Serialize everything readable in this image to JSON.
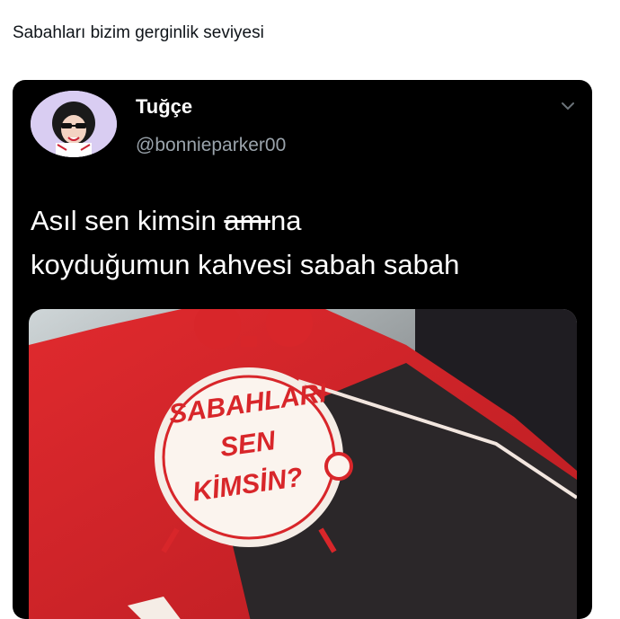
{
  "post": {
    "caption": "Sabahları bizim gerginlik seviyesi"
  },
  "tweet": {
    "author_name": "Tuğçe",
    "author_handle": "@bonnieparker00",
    "text_part1": "Asıl sen kimsin ",
    "text_redacted": "amı",
    "text_part2": "na",
    "text_line2": "koyduğumun kahvesi sabah sabah",
    "avatar_icon": "avatar-cartoon-girl-sunglasses",
    "more_icon": "chevron-down-icon"
  },
  "media": {
    "package_text": [
      "SABAHLARI",
      "SEN",
      "KİMSİN?"
    ],
    "colors": {
      "package_red": "#d8262a",
      "package_white": "#f5ede6",
      "background_dark": "#2b2729"
    }
  }
}
